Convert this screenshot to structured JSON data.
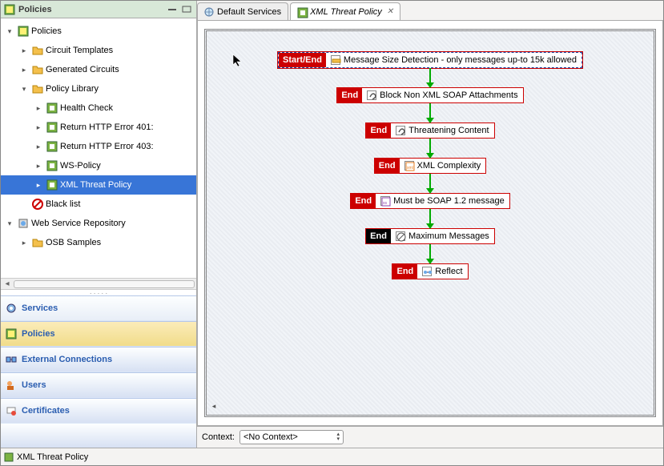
{
  "panel": {
    "title": "Policies"
  },
  "tree": [
    {
      "indent": 0,
      "toggle": "▾",
      "icon": "policies-icon",
      "label": "Policies",
      "selected": false
    },
    {
      "indent": 1,
      "toggle": "▸",
      "icon": "folder-icon",
      "label": "Circuit Templates",
      "selected": false
    },
    {
      "indent": 1,
      "toggle": "▸",
      "icon": "folder-icon",
      "label": "Generated Circuits",
      "selected": false
    },
    {
      "indent": 1,
      "toggle": "▾",
      "icon": "folder-icon",
      "label": "Policy Library",
      "selected": false
    },
    {
      "indent": 2,
      "toggle": "▸",
      "icon": "policy-icon",
      "label": "Health Check",
      "selected": false
    },
    {
      "indent": 2,
      "toggle": "▸",
      "icon": "policy-icon",
      "label": "Return HTTP Error 401:",
      "selected": false
    },
    {
      "indent": 2,
      "toggle": "▸",
      "icon": "policy-icon",
      "label": "Return HTTP Error 403:",
      "selected": false
    },
    {
      "indent": 2,
      "toggle": "▸",
      "icon": "policy-icon",
      "label": "WS-Policy",
      "selected": false
    },
    {
      "indent": 2,
      "toggle": "▸",
      "icon": "policy-icon",
      "label": "XML Threat Policy",
      "selected": true
    },
    {
      "indent": 1,
      "toggle": "",
      "icon": "deny-icon",
      "label": "Black list",
      "selected": false
    },
    {
      "indent": 0,
      "toggle": "▾",
      "icon": "repo-icon",
      "label": "Web Service Repository",
      "selected": false
    },
    {
      "indent": 1,
      "toggle": "▸",
      "icon": "folder-icon",
      "label": "OSB Samples",
      "selected": false
    }
  ],
  "categories": [
    {
      "key": "services",
      "label": "Services",
      "icon": "gear-icon"
    },
    {
      "key": "policies",
      "label": "Policies",
      "icon": "policies-icon"
    },
    {
      "key": "ext",
      "label": "External Connections",
      "icon": "conn-icon"
    },
    {
      "key": "users",
      "label": "Users",
      "icon": "users-icon"
    },
    {
      "key": "certs",
      "label": "Certificates",
      "icon": "cert-icon"
    }
  ],
  "tabs": [
    {
      "label": "Default Services",
      "icon": "globe-icon",
      "active": false,
      "closable": false
    },
    {
      "label": "XML Threat Policy",
      "icon": "policy-icon",
      "active": true,
      "closable": true
    }
  ],
  "nodes": [
    {
      "tag": "Start/End",
      "tagClass": "",
      "icon": "size-icon",
      "label": "Message Size Detection - only messages up-to 15k allowed",
      "first": true
    },
    {
      "tag": "End",
      "tagClass": "",
      "icon": "attach-icon",
      "label": "Block Non XML SOAP Attachments"
    },
    {
      "tag": "End",
      "tagClass": "",
      "icon": "attach-icon",
      "label": "Threatening Content"
    },
    {
      "tag": "End",
      "tagClass": "",
      "icon": "xml-icon",
      "label": "XML Complexity"
    },
    {
      "tag": "End",
      "tagClass": "",
      "icon": "xsd-icon",
      "label": "Must be SOAP 1.2 message"
    },
    {
      "tag": "End",
      "tagClass": "black",
      "icon": "max-icon",
      "label": "Maximum Messages"
    },
    {
      "tag": "End",
      "tagClass": "",
      "icon": "reflect-icon",
      "label": "Reflect"
    }
  ],
  "context": {
    "label": "Context:",
    "value": "<No Context>"
  },
  "status": {
    "label": "XML Threat Policy"
  }
}
